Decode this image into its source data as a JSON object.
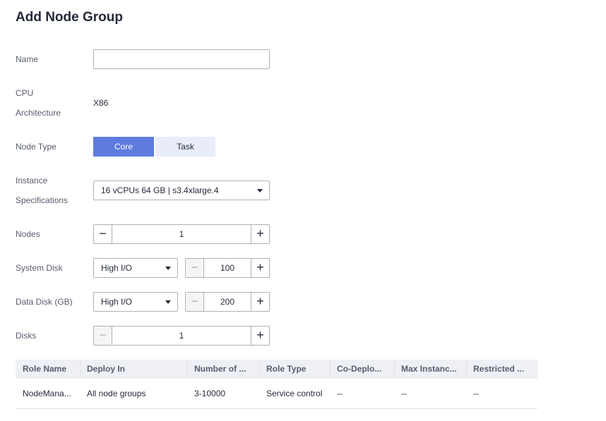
{
  "page": {
    "title": "Add Node Group"
  },
  "form": {
    "name": {
      "label": "Name",
      "value": "",
      "placeholder": ""
    },
    "cpu": {
      "label_line1": "CPU",
      "label_line2": "Architecture",
      "value": "X86"
    },
    "node_type": {
      "label": "Node Type",
      "options": [
        "Core",
        "Task"
      ],
      "selected": "Core"
    },
    "instance": {
      "label_line1": "Instance",
      "label_line2": "Specifications",
      "value": "16 vCPUs 64 GB | s3.4xlarge.4"
    },
    "nodes": {
      "label": "Nodes",
      "value": "1",
      "minus": "−",
      "plus": "+"
    },
    "system_disk": {
      "label": "System Disk",
      "type": "High I/O",
      "size": "100",
      "minus": "−",
      "plus": "+"
    },
    "data_disk": {
      "label": "Data Disk (GB)",
      "type": "High I/O",
      "size": "200",
      "minus": "−",
      "plus": "+"
    },
    "disks": {
      "label": "Disks",
      "value": "1",
      "minus": "−",
      "plus": "+"
    }
  },
  "table": {
    "headers": [
      "Role Name",
      "Deploy In",
      "Number of ...",
      "Role Type",
      "Co-Deplo...",
      "Max Instanc...",
      "Restricted ..."
    ],
    "rows": [
      [
        "NodeMana...",
        "All node groups",
        "3-10000",
        "Service control",
        "--",
        "--",
        "--"
      ]
    ]
  },
  "colors": {
    "accent": "#5e7ce0",
    "segment_inactive": "#e9edfa",
    "header_bg": "#eef0f5",
    "border": "#adb0b8"
  }
}
